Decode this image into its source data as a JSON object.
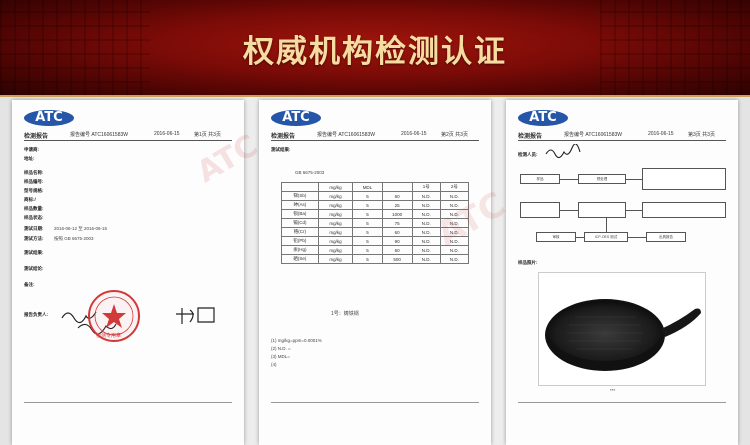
{
  "banner": {
    "title": "权威机构检测认证"
  },
  "common": {
    "logo": "ATC",
    "report_label": "检测报告",
    "report_no": "报告编号 ATC16061583W",
    "date": "2016-06-15"
  },
  "page1": {
    "page_info": "第1页 共3页",
    "fields": [
      {
        "label": "申请商:"
      },
      {
        "label": "地址:"
      },
      {
        "label": "样品名称:"
      },
      {
        "label": "样品编号:"
      },
      {
        "label": "型号规格:"
      },
      {
        "label": "商标:/"
      },
      {
        "label": "样品数量:"
      },
      {
        "label": "样品状态:"
      }
    ],
    "test_period_label": "测试日期:",
    "test_period": "2016-06-12 至 2016-06-15",
    "method_label": "测试方法:",
    "method_text": "按照 GB 6675-2003",
    "results_label": "测试结果:",
    "conclusion_label": "测试结论:",
    "remarks_label": "备注:",
    "sign_label": "报告负责人:",
    "seal_text": "检测专用章"
  },
  "page2": {
    "page_info": "第2页 共3页",
    "section_title": "测试结果:",
    "std_ref": "GB 6675-2003",
    "table": {
      "headers": [
        "",
        "mg/kg",
        "MDL",
        "",
        "1号",
        "2号"
      ],
      "rows": [
        [
          "锑(Sb)",
          "mg/kg",
          "5",
          "60",
          "N.D.",
          "N.D."
        ],
        [
          "砷(As)",
          "mg/kg",
          "5",
          "25",
          "N.D.",
          "N.D."
        ],
        [
          "钡(Ba)",
          "mg/kg",
          "5",
          "1000",
          "N.D.",
          "N.D."
        ],
        [
          "镉(Cd)",
          "mg/kg",
          "5",
          "75",
          "N.D.",
          "N.D."
        ],
        [
          "铬(Cr)",
          "mg/kg",
          "5",
          "60",
          "N.D.",
          "N.D."
        ],
        [
          "铅(Pb)",
          "mg/kg",
          "5",
          "90",
          "N.D.",
          "N.D."
        ],
        [
          "汞(Hg)",
          "mg/kg",
          "5",
          "60",
          "N.D.",
          "N.D."
        ],
        [
          "硒(Se)",
          "mg/kg",
          "5",
          "500",
          "N.D.",
          "N.D."
        ]
      ]
    },
    "sample_caption": "1号：铸铁锅",
    "notes": [
      "(1) mg/kg=ppm=0.0001%",
      "(2) N.D. =",
      "(3) MDL=",
      "(4)"
    ]
  },
  "page3": {
    "page_info": "第3页 共3页",
    "sign_label": "检测人员:",
    "flow": [
      "样品",
      "预处理",
      "ICP-OES 测试",
      "审核",
      "出具报告"
    ],
    "photo_label": "样品照片:",
    "photo_caption": "***"
  }
}
